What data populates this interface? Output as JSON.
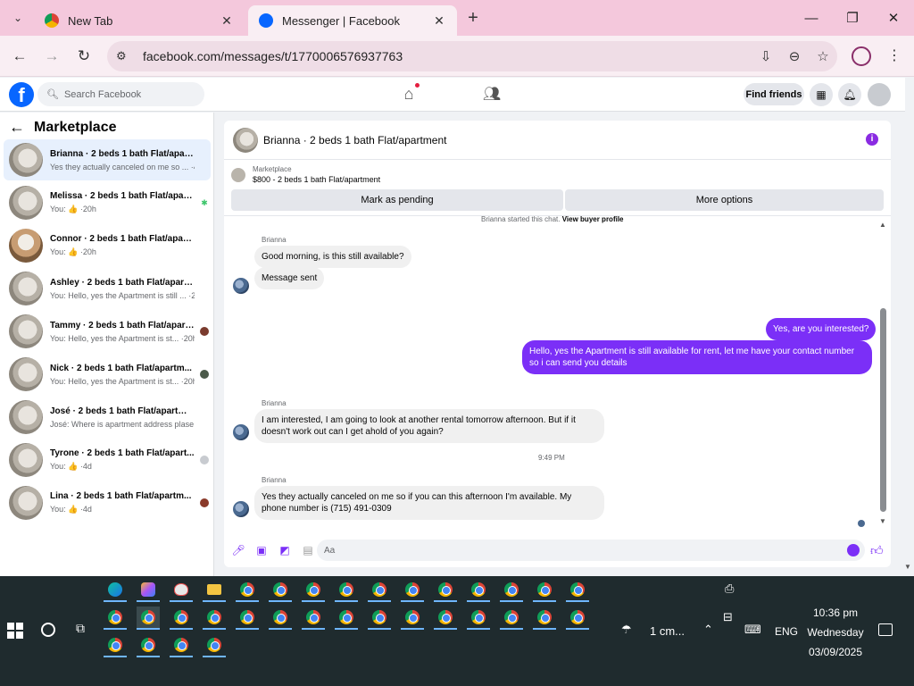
{
  "browser": {
    "tabs": [
      {
        "title": "New Tab",
        "close": "✕"
      },
      {
        "title": "Messenger | Facebook",
        "close": "✕"
      }
    ],
    "new_tab": "+",
    "url": "facebook.com/messages/t/1770006576937763",
    "window_controls": {
      "minimize": "—",
      "maximize": "❐",
      "close": "✕"
    }
  },
  "fb_header": {
    "logo": "f",
    "search_placeholder": "Search Facebook",
    "find_friends": "Find friends"
  },
  "sidebar": {
    "title": "Marketplace",
    "conversations": [
      {
        "name": "Brianna · 2 beds 1 bath Flat/apart...",
        "preview": "Yes they actually canceled on me so ... ·46m",
        "selected": true
      },
      {
        "name": "Melissa · 2 beds 1 bath Flat/apart...",
        "preview": "You: 👍 ·20h"
      },
      {
        "name": "Connor · 2 beds 1 bath Flat/apart...",
        "preview": "You: 👍 ·20h"
      },
      {
        "name": "Ashley · 2 beds 1 bath Flat/apartm...",
        "preview": "You: Hello, yes the Apartment is still ... ·20h"
      },
      {
        "name": "Tammy · 2 beds 1 bath Flat/apart...",
        "preview": "You: Hello, yes the Apartment is st... ·20h"
      },
      {
        "name": "Nick · 2 beds 1 bath Flat/apartm...",
        "preview": "You: Hello, yes the Apartment is st... ·20h"
      },
      {
        "name": "José · 2 beds 1 bath Flat/apartment",
        "preview": "José: Where is apartment address plase ·4d"
      },
      {
        "name": "Tyrone · 2 beds 1 bath Flat/apart...",
        "preview": "You: 👍 ·4d"
      },
      {
        "name": "Lina · 2 beds 1 bath Flat/apartm...",
        "preview": "You: 👍 ·4d"
      }
    ]
  },
  "chat": {
    "title": "Brianna · 2 beds 1 bath Flat/apartment",
    "listing_category": "Marketplace",
    "listing_title": "$800 - 2 beds 1 bath Flat/apartment",
    "mark_pending": "Mark as pending",
    "more_options": "More options",
    "started_text": "Brianna started this chat.",
    "view_profile": "View buyer profile",
    "sender_name": "Brianna",
    "messages": {
      "in1": "Good morning, is this still available?",
      "in2": "Message sent",
      "out1": "Yes, are you interested?",
      "out2": "Hello, yes the Apartment is still available for rent, let me have your contact number so i can send you details",
      "in3": "I am interested, I am going to look at another rental tomorrow afternoon. But if it doesn't work out can I get ahold of you again?",
      "in4": "Yes they actually canceled on me so if you can this afternoon I'm available. My phone number is (715) 491-0309"
    },
    "timestamp": "9:49 PM",
    "composer_placeholder": "Aa"
  },
  "taskbar": {
    "weather": "1 cm...",
    "language": "ENG",
    "time": "10:36 pm",
    "day": "Wednesday",
    "date": "03/09/2025"
  },
  "colors": {
    "tab_strip": "#f4c8dc",
    "accent_purple": "#7b2ff7",
    "fb_blue": "#0866ff",
    "taskbar": "#1f2b2e"
  }
}
